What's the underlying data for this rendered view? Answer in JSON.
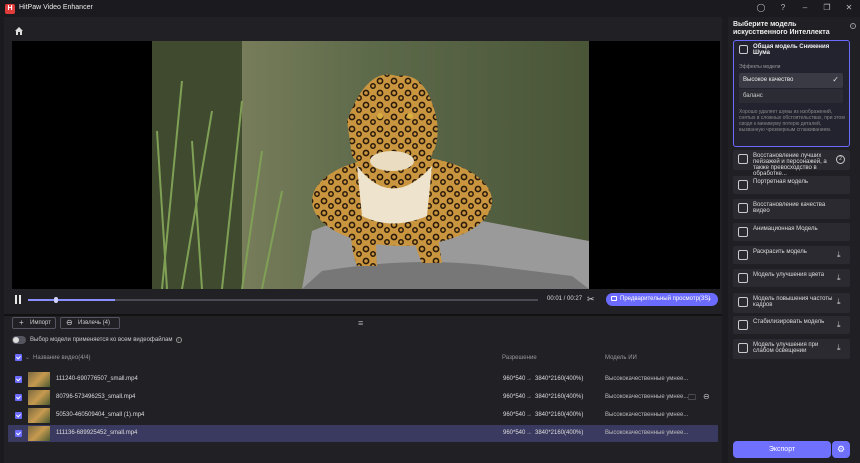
{
  "app": {
    "title": "HitPaw Video Enhancer",
    "logo_letter": "H"
  },
  "window": {
    "icons": [
      "account-icon",
      "help-icon",
      "minimize-icon",
      "restore-icon",
      "close-icon"
    ]
  },
  "player": {
    "time": "00:01 / 00:27",
    "progress_fraction": 0.17,
    "preview_label": "Предварительный просмотр(3S)"
  },
  "toolbar": {
    "import_label": "Импорт",
    "remove_label": "Извлечь (4)"
  },
  "apply_all": {
    "label": "Выбор модели применяется ко всем видеофайлам"
  },
  "table": {
    "headers": {
      "name": "Название видео(4/4)",
      "resolution": "Разрешение",
      "model": "Модель ИИ"
    },
    "rows": [
      {
        "name": "111240-690776507_small.mp4",
        "res_from": "960*540",
        "res_to": "3840*2160(400%)",
        "model": "Высококачественные умнее...",
        "selected": false
      },
      {
        "name": "80796-573496253_small.mp4",
        "res_from": "960*540",
        "res_to": "3840*2160(400%)",
        "model": "Высококачественные умнее...",
        "selected": false
      },
      {
        "name": "50530-460509404_small (1).mp4",
        "res_from": "960*540",
        "res_to": "3840*2160(400%)",
        "model": "Высококачественные умнее...",
        "selected": false
      },
      {
        "name": "111136-689925452_small.mp4",
        "res_from": "960*540",
        "res_to": "3840*2160(400%)",
        "model": "Высококачественные умнее...",
        "selected": true
      }
    ]
  },
  "sidebar": {
    "title": "Выберите модель искусственного Интеллекта",
    "active_card": {
      "title": "Общая модель Снижения Шума",
      "effects_label": "Эффекты модели",
      "options": [
        "Высокое качество",
        "баланс"
      ],
      "selected_option": "Высокое качество",
      "description": "Хорошо удаляет шумы из изображений, снятых в сложных обстоятельствах, при этом сводя к минимуму потерю деталей, вызванную чрезмерным сглаживанием."
    },
    "cards": [
      {
        "label": "Восстановление лучших пейзажей и персонажей, а также превосходство в обработке...",
        "action": "2",
        "download": false
      },
      {
        "label": "Портретная модель",
        "download": false
      },
      {
        "label": "Восстановление качества видео",
        "download": false
      },
      {
        "label": "Анимационная Модель",
        "download": false
      },
      {
        "label": "Раскрасить модель",
        "download": true
      },
      {
        "label": "Модель улучшения цвета",
        "download": true
      },
      {
        "label": "Модель повышения частоты кадров",
        "download": true
      },
      {
        "label": "Стабилизировать модель",
        "download": true
      },
      {
        "label": "Модель улучшения при слабом освещении",
        "download": true
      }
    ],
    "export_label": "Экспорт"
  }
}
